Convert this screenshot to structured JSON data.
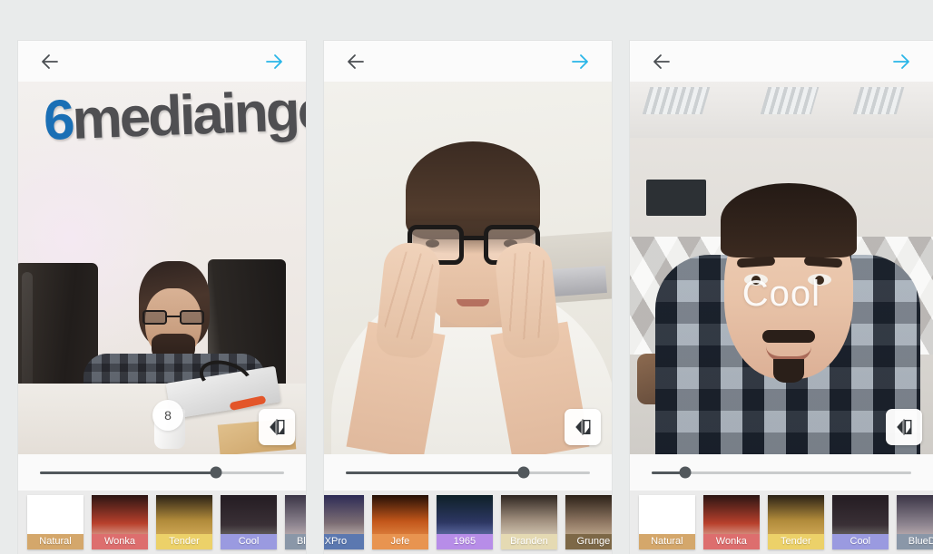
{
  "app": {
    "background_color": "#e9ebeb",
    "panel_background": "#fafafa",
    "accent_color": "#29b6e8",
    "back_arrow_color": "#4a4e52",
    "slider_color": "#52585c",
    "slider_track_color": "#c9cbcc"
  },
  "panels": [
    {
      "id": "panel-1",
      "header": {
        "back_icon": "arrow-left-icon",
        "forward_icon": "arrow-right-icon",
        "back_label": "Back",
        "forward_label": "Next"
      },
      "photo": {
        "alt": "Man with glasses and beard seated at an office desk between two monitors, company wall sign behind him",
        "wall_sign_text": "mediaingo",
        "wall_sign_initial": "6",
        "overlay_text": ""
      },
      "slider": {
        "value": 72,
        "value_label": "8",
        "show_bubble": true,
        "bubble_left_pct": 52
      },
      "compare_button": {
        "icon": "compare-split-icon",
        "label": "Compare"
      },
      "filters": [
        {
          "name": "Natural",
          "label_color": "#d4a76b",
          "thumb_top": "#ffffff",
          "thumb_mid": "#ffffff",
          "thumb_bottom": "#fdfdfd"
        },
        {
          "name": "Wonka",
          "label_color": "#dd6e6e",
          "thumb_top": "#2b1513",
          "thumb_mid": "#b8402c",
          "thumb_bottom": "#f6ede2"
        },
        {
          "name": "Tender",
          "label_color": "#ecd169",
          "thumb_top": "#2a2116",
          "thumb_mid": "#b08a3a",
          "thumb_bottom": "#e7bf6a"
        },
        {
          "name": "Cool",
          "label_color": "#9a9ae0",
          "thumb_top": "#241c22",
          "thumb_mid": "#3a3036",
          "thumb_bottom": "#9c9e96"
        },
        {
          "name": "BlueDa",
          "label_color": "#8a97a8",
          "thumb_top": "#3b3546",
          "thumb_mid": "#8f8691",
          "thumb_bottom": "#e9d6cd"
        }
      ],
      "filter_strip_offset": false
    },
    {
      "id": "panel-2",
      "header": {
        "back_icon": "arrow-left-icon",
        "forward_icon": "arrow-right-icon",
        "back_label": "Back",
        "forward_label": "Next"
      },
      "photo": {
        "alt": "Young man with black-framed glasses resting both hands on his cheeks, wearing a white sweater",
        "wall_sign_text": "",
        "wall_sign_initial": "",
        "overlay_text": ""
      },
      "slider": {
        "value": 73,
        "value_label": "",
        "show_bubble": false,
        "bubble_left_pct": 0
      },
      "compare_button": {
        "icon": "compare-split-icon",
        "label": "Compare"
      },
      "filters": [
        {
          "name": "XPro",
          "label_color": "#5b78b0",
          "thumb_top": "#2d2b55",
          "thumb_mid": "#7d6e74",
          "thumb_bottom": "#efe4dc"
        },
        {
          "name": "Jefe",
          "label_color": "#e89450",
          "thumb_top": "#241006",
          "thumb_mid": "#c2561a",
          "thumb_bottom": "#f3a45d"
        },
        {
          "name": "1965",
          "label_color": "#b78de8",
          "thumb_top": "#0e2027",
          "thumb_mid": "#2d3763",
          "thumb_bottom": "#8e9ee0"
        },
        {
          "name": "Branden",
          "label_color": "#e5dab3",
          "thumb_top": "#2e2520",
          "thumb_mid": "#9d8c7b",
          "thumb_bottom": "#faf0da"
        },
        {
          "name": "Grunge",
          "label_color": "#7d6847",
          "thumb_top": "#2b2118",
          "thumb_mid": "#8c7460",
          "thumb_bottom": "#e3cfae"
        }
      ],
      "filter_strip_offset": true
    },
    {
      "id": "panel-3",
      "header": {
        "back_icon": "arrow-left-icon",
        "forward_icon": "arrow-right-icon",
        "back_label": "Back",
        "forward_label": "Next"
      },
      "photo": {
        "alt": "Smiling man with goatee in a blue plaid shirt standing in a bright office kitchen",
        "wall_sign_text": "",
        "wall_sign_initial": "",
        "overlay_text": "Cool"
      },
      "slider": {
        "value": 13,
        "value_label": "",
        "show_bubble": false,
        "bubble_left_pct": 0
      },
      "compare_button": {
        "icon": "compare-split-icon",
        "label": "Compare"
      },
      "filters": [
        {
          "name": "Natural",
          "label_color": "#d4a76b",
          "thumb_top": "#ffffff",
          "thumb_mid": "#ffffff",
          "thumb_bottom": "#fdfdfd"
        },
        {
          "name": "Wonka",
          "label_color": "#dd6e6e",
          "thumb_top": "#2b1513",
          "thumb_mid": "#b8402c",
          "thumb_bottom": "#f6ede2"
        },
        {
          "name": "Tender",
          "label_color": "#ecd169",
          "thumb_top": "#2a2116",
          "thumb_mid": "#b08a3a",
          "thumb_bottom": "#e7bf6a"
        },
        {
          "name": "Cool",
          "label_color": "#9a9ae0",
          "thumb_top": "#241c22",
          "thumb_mid": "#3a3036",
          "thumb_bottom": "#9c9e96"
        },
        {
          "name": "BlueDa",
          "label_color": "#8a97a8",
          "thumb_top": "#3b3546",
          "thumb_mid": "#8f8691",
          "thumb_bottom": "#e9d6cd"
        }
      ],
      "filter_strip_offset": false
    }
  ]
}
